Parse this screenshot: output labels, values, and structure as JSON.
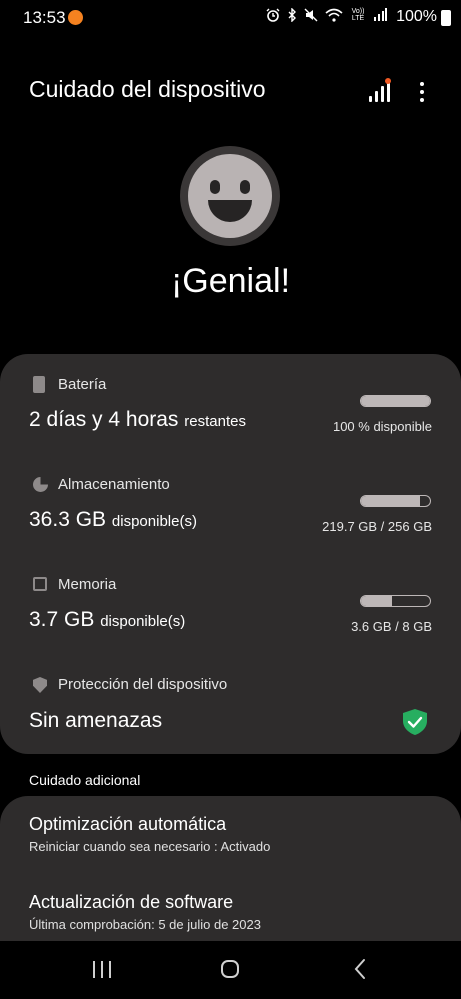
{
  "status_bar": {
    "time": "13:53",
    "icons": [
      "alarm-icon",
      "bluetooth-icon",
      "mute-icon",
      "wifi-icon",
      "volte-icon",
      "signal-icon"
    ],
    "volte_text": "Vo)) LTE",
    "battery_text": "100%"
  },
  "header": {
    "title": "Cuidado del dispositivo",
    "notification_dot_color": "#f15a24"
  },
  "status": {
    "heading": "¡Genial!"
  },
  "sections": {
    "battery": {
      "label": "Batería",
      "value": "2 días y 4 horas",
      "unit": "restantes",
      "detail": "100 % disponible",
      "fill_percent": 100
    },
    "storage": {
      "label": "Almacenamiento",
      "value": "36.3 GB",
      "unit": "disponible(s)",
      "detail": "219.7 GB / 256 GB",
      "fill_percent": 86
    },
    "memory": {
      "label": "Memoria",
      "value": "3.7 GB",
      "unit": "disponible(s)",
      "detail": "3.6 GB / 8 GB",
      "fill_percent": 45
    },
    "protection": {
      "label": "Protección del dispositivo",
      "value": "Sin amenazas",
      "status_color": "#27ae60"
    }
  },
  "additional": {
    "heading": "Cuidado adicional",
    "items": [
      {
        "title": "Optimización automática",
        "subtitle": "Reiniciar cuando sea necesario : Activado"
      },
      {
        "title": "Actualización de software",
        "subtitle": "Última comprobación: 5 de julio de 2023"
      }
    ]
  },
  "colors": {
    "background": "#000000",
    "card": "#2e2c2c",
    "accent_orange": "#f58220",
    "secure_green": "#27ae60"
  }
}
